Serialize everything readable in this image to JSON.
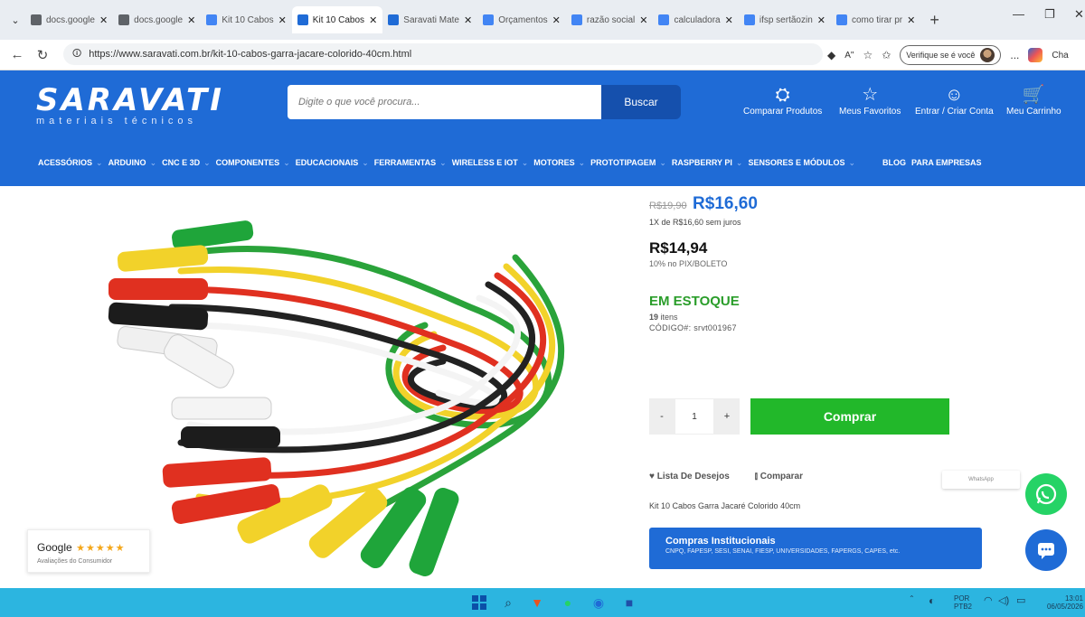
{
  "browser": {
    "tabs": [
      {
        "label": "docs.google",
        "fav_color": "#5f6368",
        "active": false
      },
      {
        "label": "docs.google",
        "fav_color": "#5f6368",
        "active": false
      },
      {
        "label": "Kit 10 Cabos",
        "fav_color": "#4285f4",
        "active": false
      },
      {
        "label": "Kit 10 Cabos",
        "fav_color": "#1f6bd6",
        "active": true
      },
      {
        "label": "Saravati Mate",
        "fav_color": "#1f6bd6",
        "active": false
      },
      {
        "label": "Orçamentos",
        "fav_color": "#4285f4",
        "active": false
      },
      {
        "label": "razão social",
        "fav_color": "#4285f4",
        "active": false
      },
      {
        "label": "calculadora",
        "fav_color": "#4285f4",
        "active": false
      },
      {
        "label": "ifsp sertãozin",
        "fav_color": "#4285f4",
        "active": false
      },
      {
        "label": "como tirar pr",
        "fav_color": "#4285f4",
        "active": false
      }
    ],
    "url": "https://www.saravati.com.br/kit-10-cabos-garra-jacare-colorido-40cm.html",
    "verify_label": "Verifique se é você",
    "more_label": "...",
    "copilot_label": "Cha"
  },
  "site": {
    "brand": "SARAVATI",
    "tagline": "materiais técnicos",
    "search_placeholder": "Digite o que você procura...",
    "search_button": "Buscar",
    "actions": [
      {
        "label": "Comparar Produtos",
        "icon": "compare-icon"
      },
      {
        "label": "Meus Favoritos",
        "icon": "star-icon"
      },
      {
        "label": "Entrar / Criar Conta",
        "icon": "user-icon"
      },
      {
        "label": "Meu Carrinho",
        "icon": "cart-icon"
      }
    ],
    "categories": [
      {
        "label": "ACESSÓRIOS",
        "dd": true
      },
      {
        "label": "ARDUINO",
        "dd": true
      },
      {
        "label": "CNC E 3D",
        "dd": true
      },
      {
        "label": "COMPONENTES",
        "dd": true
      },
      {
        "label": "EDUCACIONAIS",
        "dd": true
      },
      {
        "label": "FERRAMENTAS",
        "dd": true
      },
      {
        "label": "WIRELESS E IOT",
        "dd": true
      },
      {
        "label": "MOTORES",
        "dd": true
      },
      {
        "label": "PROTOTIPAGEM",
        "dd": true
      },
      {
        "label": "RASPBERRY PI",
        "dd": true
      },
      {
        "label": "SENSORES E MÓDULOS",
        "dd": true
      },
      {
        "label": "BLOG",
        "dd": false
      },
      {
        "label": "PARA EMPRESAS",
        "dd": false
      }
    ]
  },
  "product": {
    "old_price": "R$19,90",
    "price": "R$16,60",
    "installment": "1X de R$16,60 sem juros",
    "pix_price": "R$14,94",
    "pix_note": "10% no PIX/BOLETO",
    "stock_status": "EM ESTOQUE",
    "stock_count": "19",
    "stock_unit": "itens",
    "sku_label": "CÓDIGO#:",
    "sku": "srvt001967",
    "qty_minus": "-",
    "qty_value": "1",
    "qty_plus": "+",
    "buy_label": "Comprar",
    "wishlist_label": "Lista De Desejos",
    "compare_label": "Comparar",
    "name": "Kit 10 Cabos Garra Jacaré Colorido 40cm",
    "institutional_title": "Compras Institucionais",
    "institutional_sub": "CNPQ, FAPESP, SESI, SENAI, FIESP, UNIVERSIDADES, FAPERGS, CAPES, etc."
  },
  "google_badge": {
    "label": "Google",
    "stars": "★★★★★",
    "sub": "Avaliações do Consumidor"
  },
  "whatsapp_tip": "WhatsApp",
  "taskbar": {
    "lang": "POR",
    "lang_sub": "PTB2",
    "time": "13:01",
    "date": "06/05/2026"
  },
  "colors": {
    "brand_blue": "#1f6bd6",
    "buy_green": "#22b82a",
    "stock_green": "#2a9d2a",
    "taskbar": "#2cb5e0"
  }
}
